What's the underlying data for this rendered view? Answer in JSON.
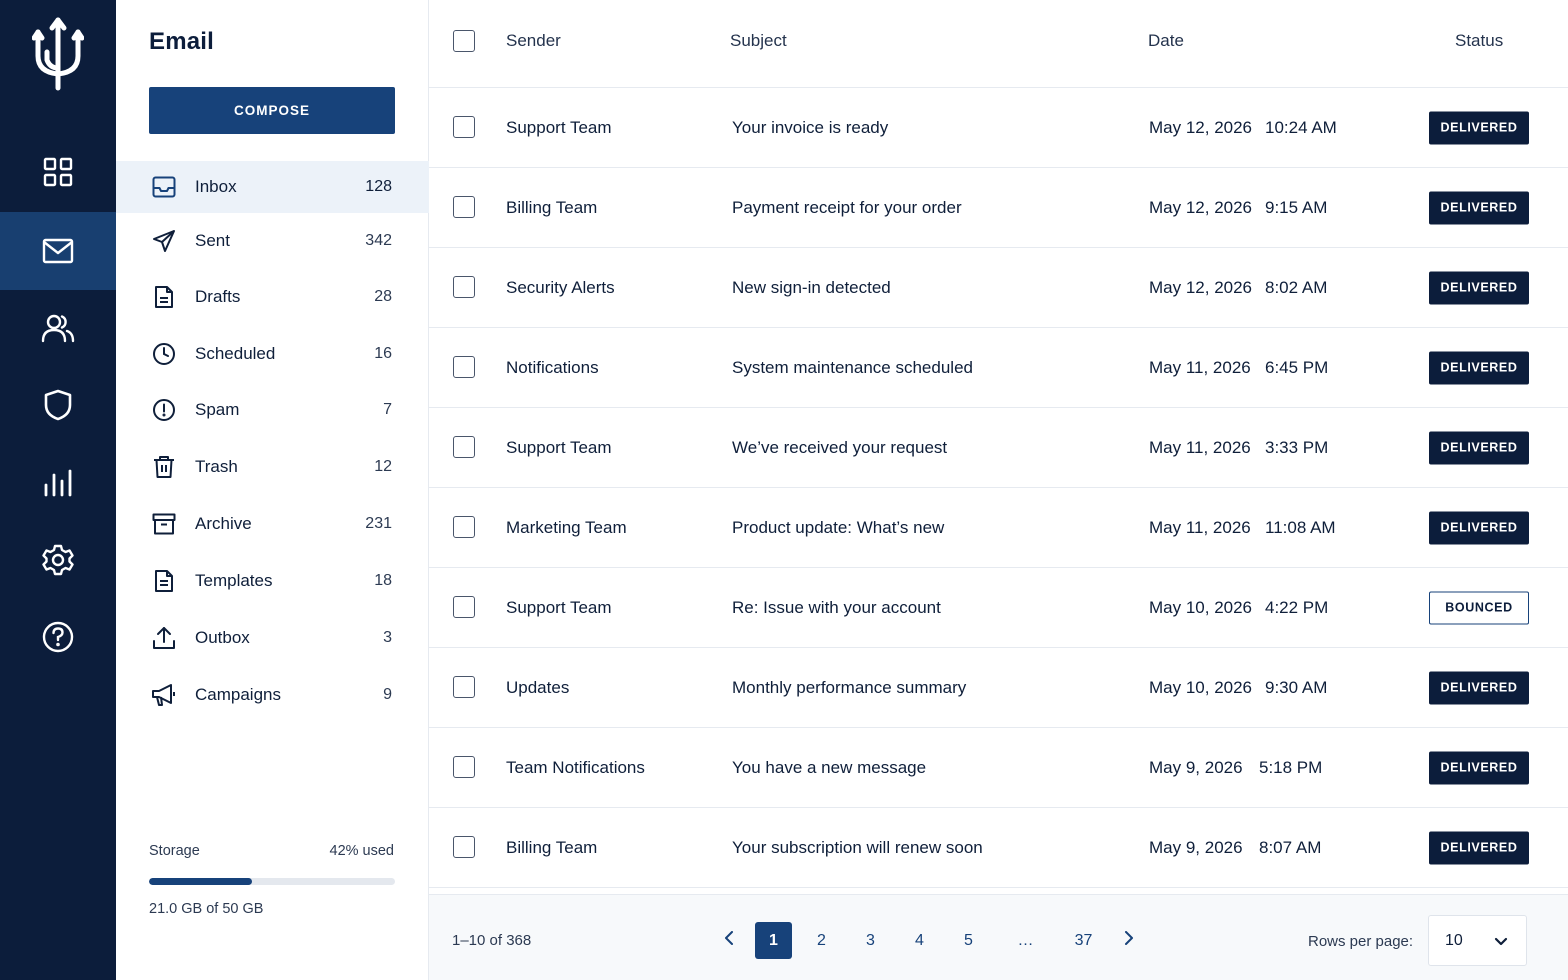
{
  "colors": {
    "rail_bg": "#0c1d3b",
    "accent": "#17427a",
    "active_folder_bg": "#ecf2f9"
  },
  "rail": {
    "logo_icon": "trident-icon",
    "items": [
      {
        "icon": "dashboard-icon",
        "active": false
      },
      {
        "icon": "mail-icon",
        "active": true
      },
      {
        "icon": "users-icon",
        "active": false
      },
      {
        "icon": "shield-icon",
        "active": false
      },
      {
        "icon": "bar-chart-icon",
        "active": false
      },
      {
        "icon": "gear-icon",
        "active": false
      },
      {
        "icon": "help-icon",
        "active": false
      }
    ]
  },
  "panel": {
    "title": "Email",
    "compose_label": "COMPOSE",
    "folders": [
      {
        "icon": "inbox-icon",
        "label": "Inbox",
        "count": "128",
        "active": true
      },
      {
        "icon": "send-icon",
        "label": "Sent",
        "count": "342"
      },
      {
        "icon": "document-icon",
        "label": "Drafts",
        "count": "28"
      },
      {
        "icon": "clock-icon",
        "label": "Scheduled",
        "count": "16"
      },
      {
        "icon": "alert-icon",
        "label": "Spam",
        "count": "7"
      },
      {
        "icon": "trash-icon",
        "label": "Trash",
        "count": "12"
      },
      {
        "icon": "archive-icon",
        "label": "Archive",
        "count": "231"
      },
      {
        "icon": "template-icon",
        "label": "Templates",
        "count": "18"
      },
      {
        "icon": "upload-icon",
        "label": "Outbox",
        "count": "3"
      },
      {
        "icon": "megaphone-icon",
        "label": "Campaigns",
        "count": "9"
      }
    ],
    "storage": {
      "label": "Storage",
      "percent_text": "42% used",
      "used_fraction": 0.42,
      "detail": "21.0 GB of 50 GB"
    }
  },
  "table": {
    "headers": {
      "sender": "Sender",
      "subject": "Subject",
      "date": "Date",
      "status": "Status"
    },
    "rows": [
      {
        "sender": "Support Team",
        "subject": "Your invoice is ready",
        "date": "May 12, 2026",
        "time": "10:24 AM",
        "status": "DELIVERED"
      },
      {
        "sender": "Billing Team",
        "subject": "Payment receipt for your order",
        "date": "May 12, 2026",
        "time": "9:15 AM",
        "status": "DELIVERED"
      },
      {
        "sender": "Security Alerts",
        "subject": "New sign-in detected",
        "date": "May 12, 2026",
        "time": "8:02 AM",
        "status": "DELIVERED"
      },
      {
        "sender": "Notifications",
        "subject": "System maintenance scheduled",
        "date": "May 11, 2026",
        "time": "6:45 PM",
        "status": "DELIVERED"
      },
      {
        "sender": "Support Team",
        "subject": "We’ve received your request",
        "date": "May 11, 2026",
        "time": "3:33 PM",
        "status": "DELIVERED"
      },
      {
        "sender": "Marketing Team",
        "subject": "Product update: What’s new",
        "date": "May 11, 2026",
        "time": "11:08 AM",
        "status": "DELIVERED"
      },
      {
        "sender": "Support Team",
        "subject": "Re: Issue with your account",
        "date": "May 10, 2026",
        "time": "4:22 PM",
        "status": "BOUNCED"
      },
      {
        "sender": "Updates",
        "subject": "Monthly performance summary",
        "date": "May 10, 2026",
        "time": "9:30 AM",
        "status": "DELIVERED"
      },
      {
        "sender": "Team Notifications",
        "subject": "You have a new message",
        "date": "May 9, 2026",
        "time": "5:18 PM",
        "status": "DELIVERED"
      },
      {
        "sender": "Billing Team",
        "subject": "Your subscription will renew soon",
        "date": "May 9, 2026",
        "time": "8:07 AM",
        "status": "DELIVERED"
      }
    ]
  },
  "pagination": {
    "range_text": "1–10 of 368",
    "prev_icon": "chevron-left-icon",
    "next_icon": "chevron-right-icon",
    "pages": [
      "1",
      "2",
      "3",
      "4",
      "5",
      "…",
      "37"
    ],
    "current_page": "1",
    "rows_per_page_label": "Rows per page:",
    "rows_per_page_value": "10"
  }
}
